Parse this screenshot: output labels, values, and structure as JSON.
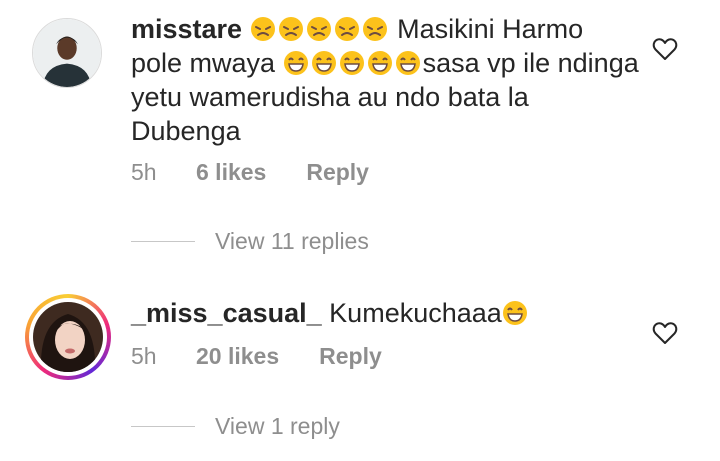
{
  "comments": [
    {
      "username": "misstare",
      "text_parts": [
        "Masikini Harmo pole mwaya ",
        "sasa vp ile ndinga yetu wamerudisha au ndo bata la Dubenga"
      ],
      "time": "5h",
      "likes": "6 likes",
      "reply": "Reply",
      "view_replies": "View 11 replies"
    },
    {
      "username": "_miss_casual_",
      "text_parts": [
        "Kumekuchaaa"
      ],
      "time": "5h",
      "likes": "20 likes",
      "reply": "Reply",
      "view_replies": "View 1 reply"
    }
  ],
  "icons": [
    "heart-icon",
    "sad-face-emoji",
    "laughing-emoji"
  ],
  "colors": {
    "text": "#262626",
    "muted": "#8e8e8e",
    "emoji": "#fcc21b"
  }
}
